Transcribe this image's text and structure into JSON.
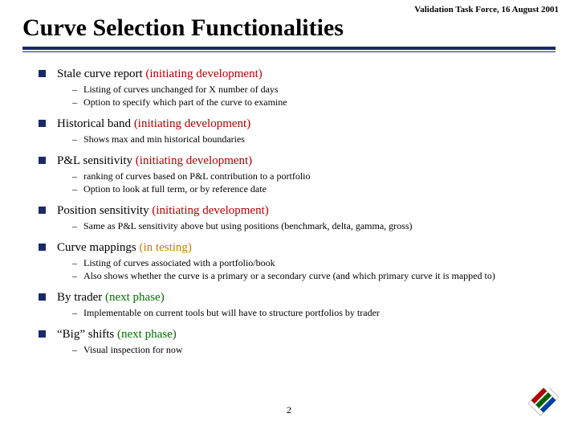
{
  "header_date": "Validation Task Force, 16 August 2001",
  "title": "Curve Selection Functionalities",
  "status": {
    "dev": "(initiating development)",
    "test": "(in testing)",
    "next": "(next phase)"
  },
  "items": [
    {
      "label": "Stale curve report ",
      "status": "dev",
      "subs": [
        "Listing of curves unchanged for X number of days",
        "Option to specify which part of the curve to examine"
      ]
    },
    {
      "label": "Historical band ",
      "status": "dev",
      "subs": [
        "Shows max and min historical boundaries"
      ]
    },
    {
      "label": "P&L sensitivity ",
      "status": "dev",
      "subs": [
        "ranking of curves based on P&L contribution to a portfolio",
        "Option to look at full term, or by reference date"
      ]
    },
    {
      "label": "Position sensitivity ",
      "status": "dev",
      "subs": [
        "Same as P&L sensitivity above but using positions (benchmark, delta, gamma, gross)"
      ]
    },
    {
      "label": "Curve mappings ",
      "status": "test",
      "subs": [
        "Listing of curves associated with a portfolio/book",
        "Also shows whether the curve is a primary or a secondary curve (and which primary curve it is mapped to)"
      ]
    },
    {
      "label": "By trader ",
      "status": "next",
      "subs": [
        "Implementable on current tools but will have to structure portfolios by trader"
      ]
    },
    {
      "label": "“Big” shifts ",
      "status": "next",
      "subs": [
        "Visual inspection for now"
      ]
    }
  ],
  "page_number": "2"
}
